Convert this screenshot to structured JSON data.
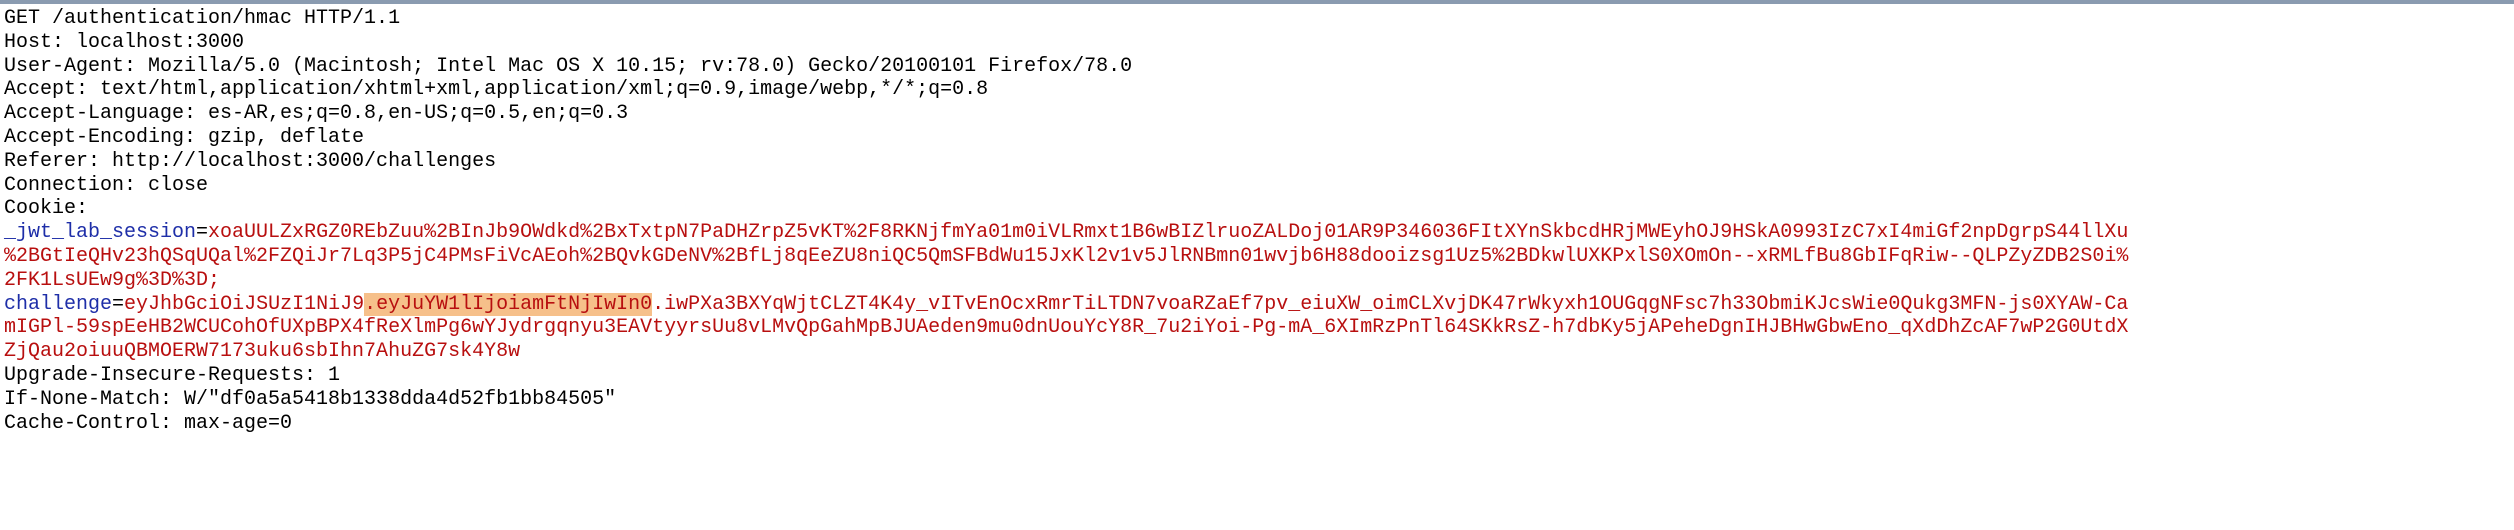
{
  "request": {
    "request_line": "GET /authentication/hmac HTTP/1.1",
    "host": "Host: localhost:3000",
    "user_agent": "User-Agent: Mozilla/5.0 (Macintosh; Intel Mac OS X 10.15; rv:78.0) Gecko/20100101 Firefox/78.0",
    "accept": "Accept: text/html,application/xhtml+xml,application/xml;q=0.9,image/webp,*/*;q=0.8",
    "accept_language": "Accept-Language: es-AR,es;q=0.8,en-US;q=0.5,en;q=0.3",
    "accept_encoding": "Accept-Encoding: gzip, deflate",
    "referer": "Referer: http://localhost:3000/challenges",
    "connection": "Connection: close",
    "cookie_header": "Cookie:",
    "jwt_session": {
      "name": "_jwt_lab_session",
      "equals": "=",
      "value_line1": "xoaUULZxRGZ0REbZuu%2BInJb9OWdkd%2BxTxtpN7PaDHZrpZ5vKT%2F8RKNjfmYa01m0iVLRmxt1B6wBIZlruoZALDoj01AR9P346036FItXYnSkbcdHRjMWEyhOJ9HSkA0993IzC7xI4miGf2npDgrpS44llXu",
      "value_line2": "%2BGtIeQHv23hQSqUQal%2FZQiJr7Lq3P5jC4PMsFiVcAEoh%2BQvkGDeNV%2BfLj8qEeZU8niQC5QmSFBdWu15JxKl2v1v5JlRNBmn01wvjb6H88dooizsg1Uz5%2BDkwlUXKPxlS0XOmOn--xRMLfBu8GbIFqRiw--QLPZyZDB2S0i%",
      "value_line3": "2FK1LsUEw9g%3D%3D;"
    },
    "challenge": {
      "name": "challenge",
      "equals": "=",
      "value_part1": "eyJhbGciOiJSUzI1NiJ9",
      "value_highlighted": ".eyJuYW1lIjoiamFtNjIwIn0",
      "value_part2": ".iwPXa3BXYqWjtCLZT4K4y_vITvEnOcxRmrTiLTDN7voaRZaEf7pv_eiuXW_oimCLXvjDK47rWkyxh1OUGqgNFsc7h33ObmiKJcsWie0Qukg3MFN-js0XYAW-Ca",
      "value_line2": "mIGPl-59spEeHB2WCUCohOfUXpBPX4fReXlmPg6wYJydrgqnyu3EAVtyyrsUu8vLMvQpGahMpBJUAeden9mu0dnUouYcY8R_7u2iYoi-Pg-mA_6XImRzPnTl64SKkRsZ-h7dbKy5jAPeheDgnIHJBHwGbwEno_qXdDhZcAF7wP2G0UtdX",
      "value_line3": "ZjQau2oiuuQBMOERW7173uku6sbIhn7AhuZG7sk4Y8w"
    },
    "upgrade_insecure": "Upgrade-Insecure-Requests: 1",
    "if_none_match": "If-None-Match: W/\"df0a5a5418b1338dda4d52fb1bb84505\"",
    "cache_control": "Cache-Control: max-age=0"
  },
  "colors": {
    "cookie_name": "#1e2ea8",
    "cookie_value": "#b80f0f",
    "highlight": "#f6c08a"
  }
}
